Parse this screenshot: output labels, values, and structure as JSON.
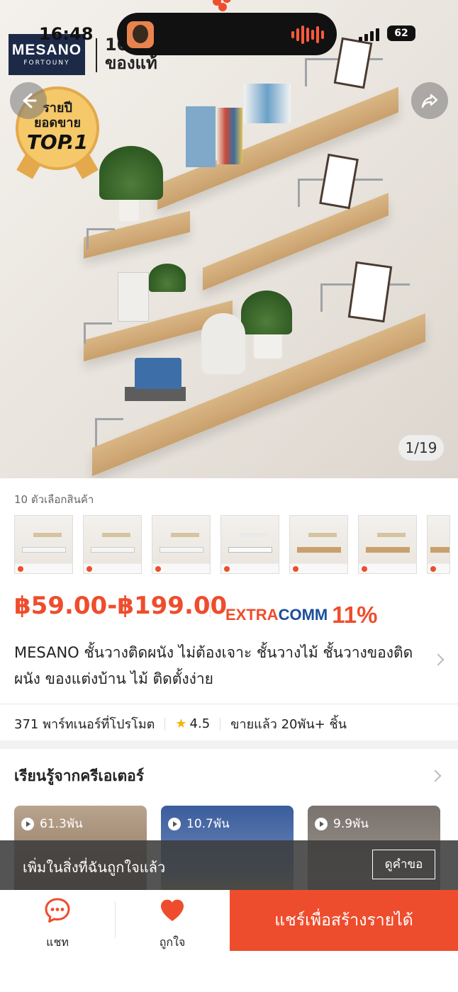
{
  "status": {
    "time": "16:48",
    "battery": "62"
  },
  "hero": {
    "brand_name": "MESANO",
    "brand_sub": "FORTOUNY",
    "brand_tag_1": "10",
    "brand_tag_2": "ของแท้",
    "badge_line1": "รายปี",
    "badge_line2": "ยอดขาย",
    "badge_line3": "TOP.1",
    "image_counter": "1/19"
  },
  "product": {
    "variants_label": "10 ตัวเลือกสินค้า",
    "price": "฿59.00-฿199.00",
    "extra_label_1": "EXTRA",
    "extra_label_2": "COMM",
    "extra_percent": "11%",
    "title": "MESANO ชั้นวางติดผนัง ไม่ต้องเจาะ ชั้นวางไม้ ชั้นวางของติดผนัง  ของแต่งบ้าน ไม้ ติดตั้งง่าย",
    "partners": "371 พาร์ทเนอร์ที่โปรโมต",
    "rating": "4.5",
    "sold": "ขายแล้ว 20พัน+ ชิ้น"
  },
  "creators": {
    "title": "เรียนรู้จากครีเอเตอร์",
    "cards": [
      {
        "views": "61.3พัน"
      },
      {
        "views": "10.7พัน"
      },
      {
        "views": "9.9พัน"
      }
    ]
  },
  "toast": {
    "message": "เพิ่มในสิ่งที่ฉันถูกใจแล้ว",
    "action": "ดูคำขอ"
  },
  "bottom_bar": {
    "chat_label": "แชท",
    "like_label": "ถูกใจ",
    "share_label": "แชร์เพื่อสร้างรายได้"
  },
  "colors": {
    "accent": "#ee4d2d",
    "comm_blue": "#1b4d9c"
  }
}
